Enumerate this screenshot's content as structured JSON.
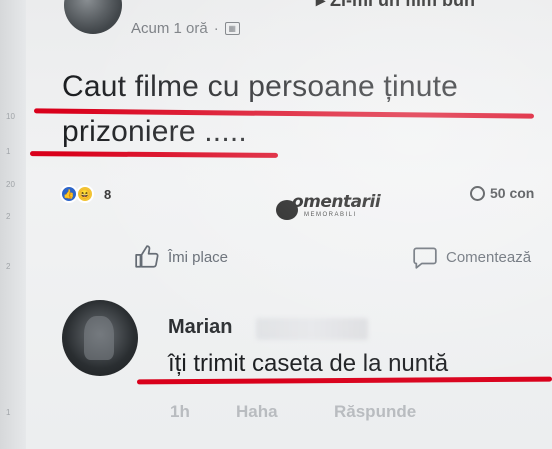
{
  "post": {
    "header_partial": "Zi-mi un film bun",
    "timestamp": "Acum 1 oră",
    "audience_icon": "globe-icon",
    "text_line1": "Caut filme cu persoane ținute",
    "text_line2": "prizoniere .....",
    "reaction_count": "8",
    "comments_count": "50 con"
  },
  "watermark": {
    "text": "omentarii",
    "subtext": "MEMORABILI"
  },
  "actions": {
    "like_label": "Îmi place",
    "comment_label": "Comentează"
  },
  "comment": {
    "author": "Marian",
    "text": "îți trimit caseta de la nuntă",
    "time": "1h",
    "haha_label": "Haha",
    "reply_label": "Răspunde"
  },
  "colors": {
    "underline": "#d9001b",
    "like": "#2d65c8",
    "haha": "#f2c230"
  }
}
